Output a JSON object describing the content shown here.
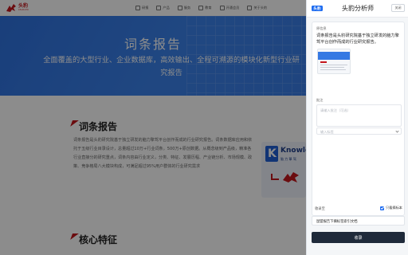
{
  "site": {
    "logo_name": "头豹",
    "logo_sub": "LEADLEO",
    "nav": [
      {
        "label": "研报",
        "icon": "report-icon"
      },
      {
        "label": "产品",
        "icon": "product-icon"
      },
      {
        "label": "服务",
        "icon": "service-icon"
      },
      {
        "label": "教育",
        "icon": "education-icon"
      },
      {
        "label": "开通会员",
        "icon": "membership-icon"
      },
      {
        "label": "关于头豹",
        "icon": "about-icon"
      }
    ],
    "hero_title": "词条报告",
    "hero_subtitle": "全面覆盖的大型行业、企业数据库，高效输出、全程可溯源的模块化新型行业研究报告",
    "section_title": "词条报告",
    "section_body": "词条报告是头豹研究院基于独立研发的脑力擎驾平台创作而成的行业研究报告。词条数据库应用和依托于五级行业目录设计，总量超过10万+行业词条，500万+原创数据。从概念级到产品级，精准各行业直接分的研究重点，词条内容由行业定义，分类、特征、发展历程、产业链分析、市场规模、政策、竞争格局八大模块构成，可满足超过95%用户群体的行业研究需求",
    "know_title": "Knowle",
    "know_sub": "脑 力 擎 驾",
    "section2_title": "核心特征"
  },
  "panel": {
    "app_logo": "头豹",
    "title": "头豹分析师",
    "close_label": "关闭",
    "source_label": "原信息",
    "source_text": "词条报告是头豹研究院基于独立研发的脑力擎驾平台创作而成的行业研究报告。",
    "note_label": "批注",
    "note_placeholder": "请输入批注（可选）",
    "tag_placeholder": "输入标签",
    "collect_label": "收录至",
    "new_doc_label": "只看摘标本",
    "select_value": "鼠盟报告下摘标签索引文档",
    "submit_label": "收录"
  },
  "colors": {
    "brand_red": "#c4161c",
    "hero_blue": "#3579e3",
    "accent_blue": "#1e6cf0",
    "submit_dark": "#1f2a3a"
  }
}
